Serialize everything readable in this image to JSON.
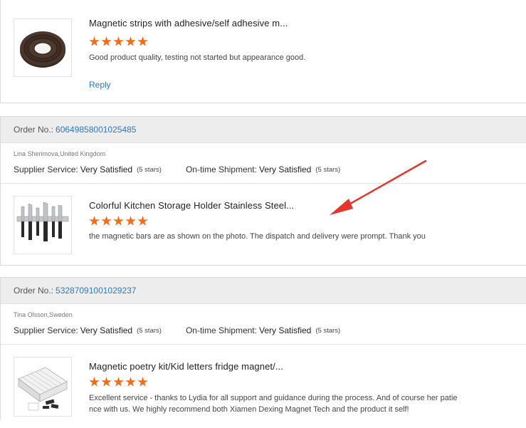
{
  "labels": {
    "order_no": "Order No.:",
    "supplier_service": "Supplier Service:",
    "shipment": "On-time Shipment:"
  },
  "reviews": [
    {
      "product_title": "Magnetic strips with adhesive/self adhesive m...",
      "rating": 5,
      "comment": "Good product quality, testing not started but appearance good.",
      "reply": "Reply",
      "thumb_icon": "magnetic-tape-roll"
    },
    {
      "order_no": "60649858001025485",
      "buyer": "Lina Sherimova,United Kingdom",
      "supplier_service_value": "Very Satisfied",
      "supplier_service_stars": "(5 stars)",
      "shipment_value": "Very Satisfied",
      "shipment_stars": "(5 stars)",
      "product_title": "Colorful Kitchen Storage Holder Stainless Steel...",
      "rating": 5,
      "comment": "the magnetic bars are as shown on the photo.  The dispatch and delivery were prompt. Thank you",
      "thumb_icon": "knife-magnetic-bar"
    },
    {
      "order_no": "53287091001029237",
      "buyer": "Tina Olsson,Sweden",
      "supplier_service_value": "Very Satisfied",
      "supplier_service_stars": "(5 stars)",
      "shipment_value": "Very Satisfied",
      "shipment_stars": "(5 stars)",
      "product_title": "Magnetic poetry kit/Kid letters fridge magnet/...",
      "rating": 5,
      "comment_line1": "Excellent service - thanks to Lydia for all support and guidance during the process. And of course her patie",
      "comment_line2": "nce with us. We highly recommend both Xiamen Dexing Magnet Tech and the product it self!",
      "thumb_icon": "magnetic-letter-tiles"
    }
  ],
  "colors": {
    "accent_link": "#2b78c5",
    "star": "#f56b16",
    "arrow": "#e8342b",
    "header_bg": "#ededed"
  }
}
